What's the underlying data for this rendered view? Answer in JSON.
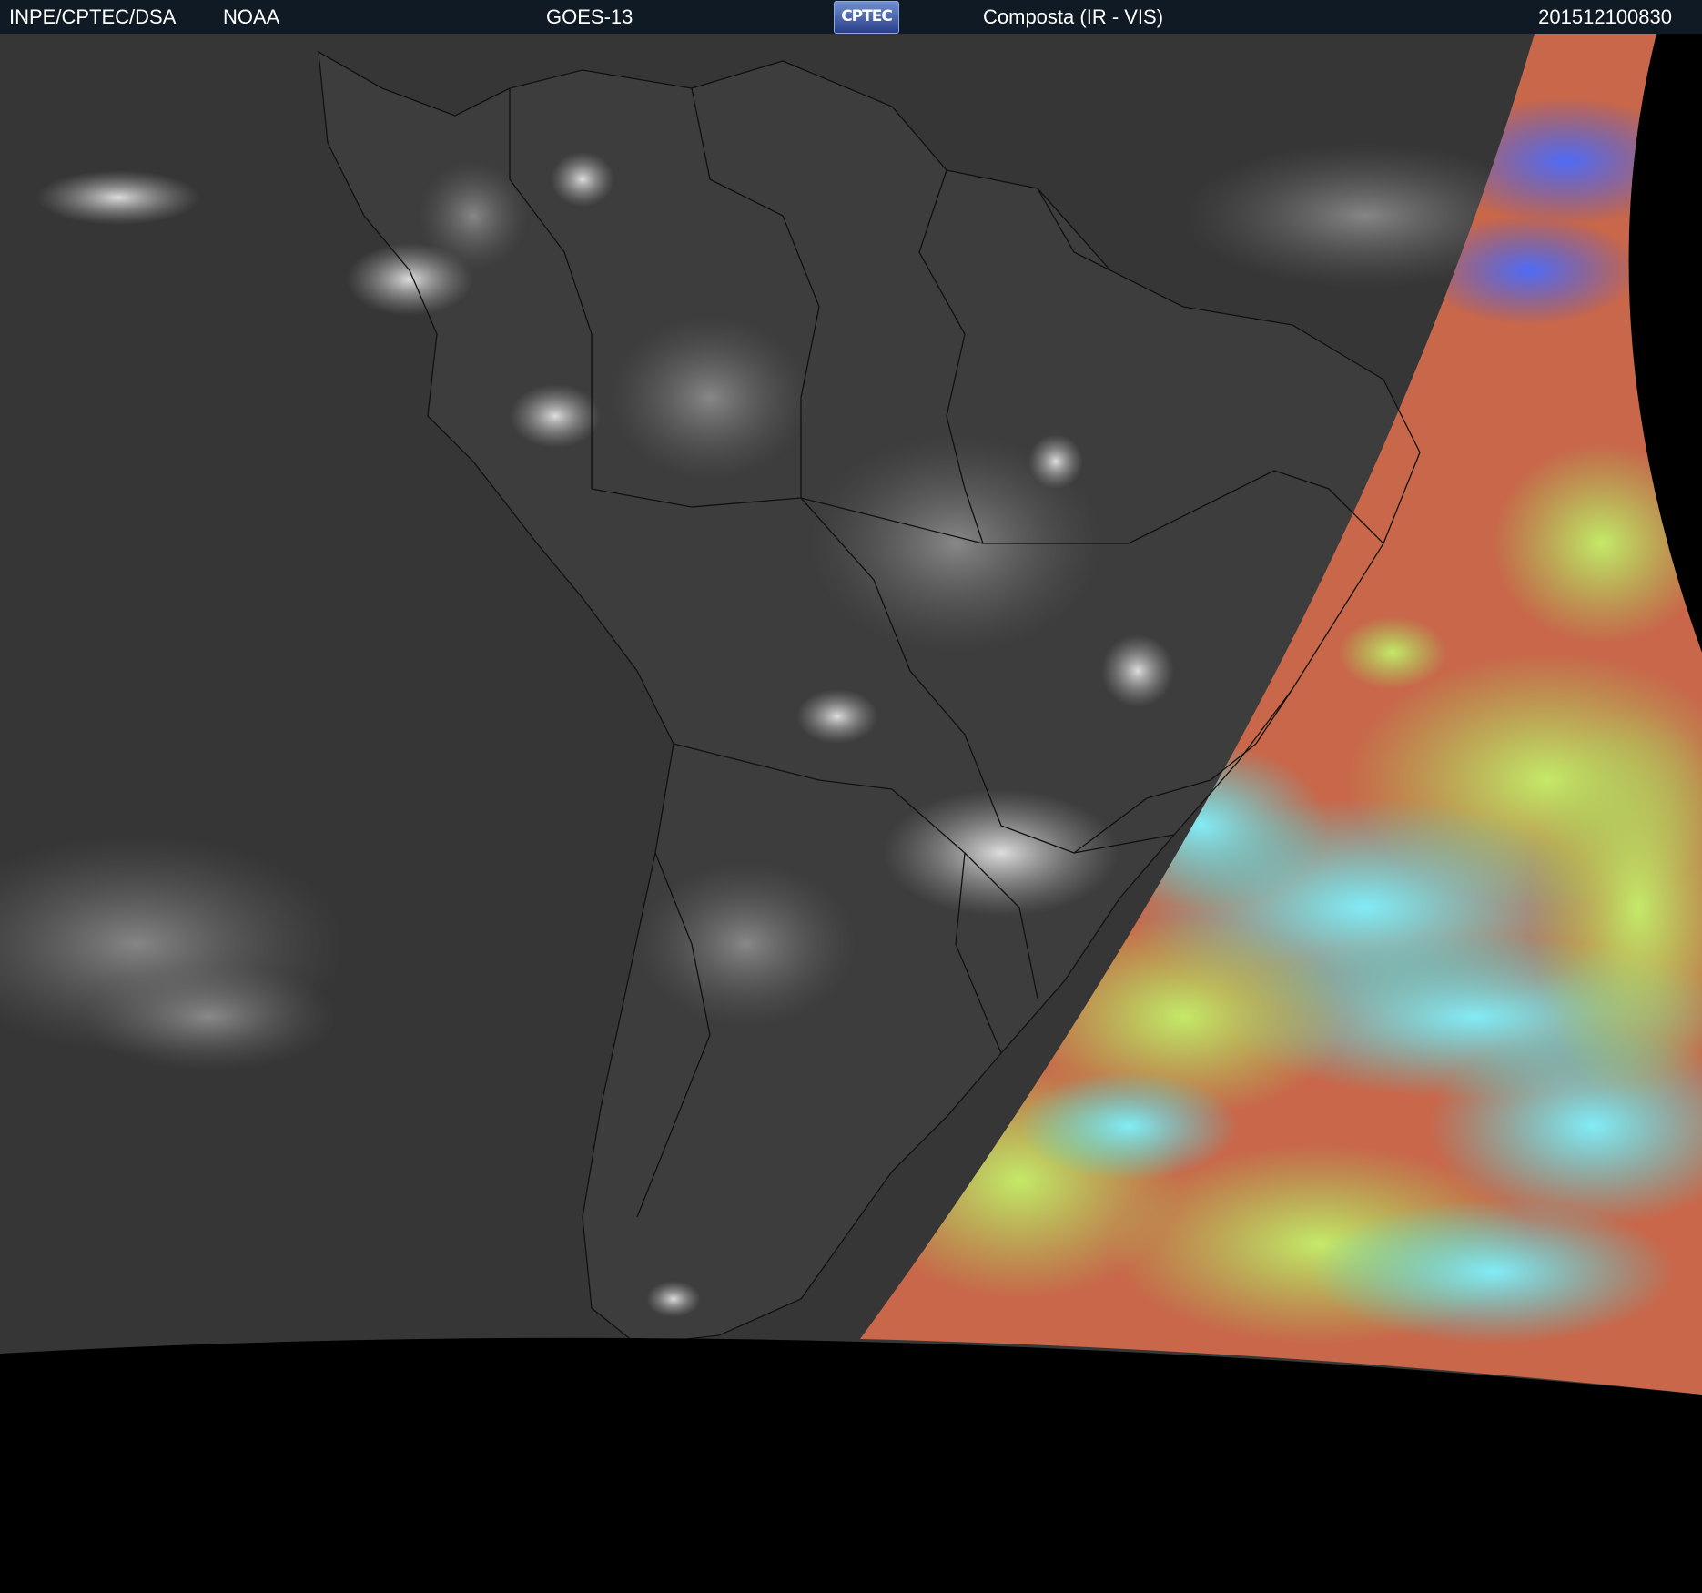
{
  "header": {
    "organization": "INPE/CPTEC/DSA",
    "agency": "NOAA",
    "satellite": "GOES-13",
    "logo_text": "CPTEC",
    "product": "Composta (IR - VIS)",
    "timestamp": "201512100830"
  },
  "colors": {
    "header_bg": "#0f1a24",
    "space": "#000000",
    "ir_land": "#3a3a3a",
    "ir_ocean": "#333333",
    "vis_red": "#c8674a",
    "vis_green": "#9ee05a",
    "vis_cyan": "#33e6f0",
    "vis_blue": "#3a5ff0"
  }
}
